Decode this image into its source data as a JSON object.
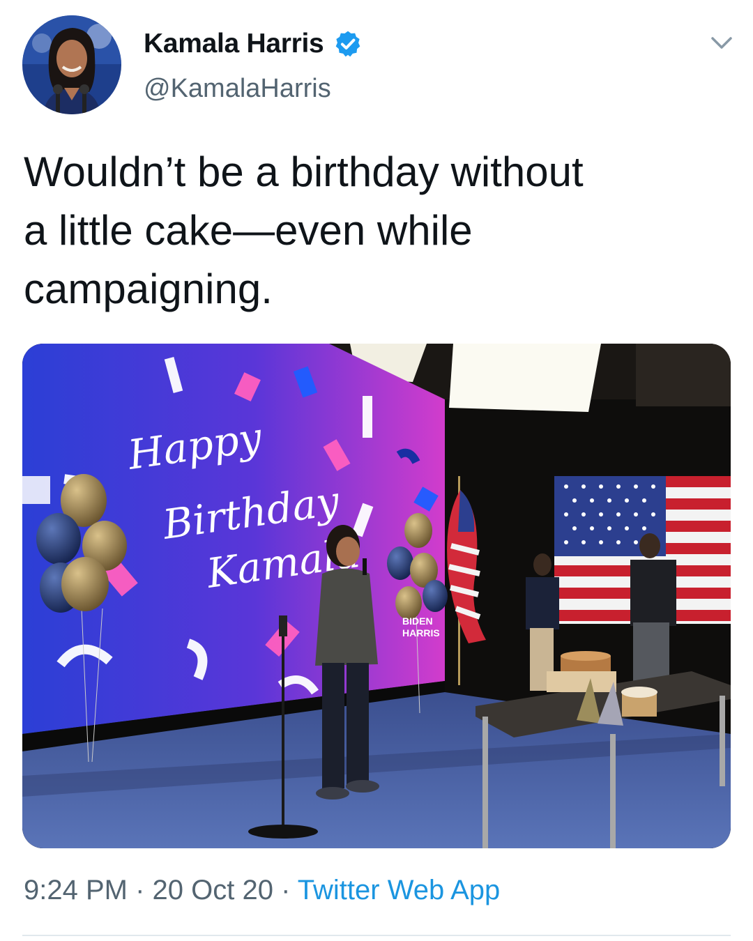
{
  "user": {
    "display_name": "Kamala Harris",
    "handle": "@KamalaHarris",
    "verified": true,
    "avatar": "profile-photo"
  },
  "tweet": {
    "text": "Wouldn’t be a birthday without\na little cake—even while\ncampaigning."
  },
  "media": {
    "screen_script": [
      "Happy",
      "Birthday",
      "Kamala"
    ],
    "sign_top": "BIDEN",
    "sign_bottom": "HARRIS"
  },
  "meta": {
    "time": "9:24 PM",
    "separator": " · ",
    "date": "20 Oct 20",
    "source": "Twitter Web App"
  },
  "icons": {
    "verified": "verified-badge-icon",
    "menu": "chevron-down-icon"
  },
  "colors": {
    "text_primary": "#0f1419",
    "text_secondary": "#536471",
    "link": "#1b95e0",
    "verified": "#1d9bf0"
  }
}
